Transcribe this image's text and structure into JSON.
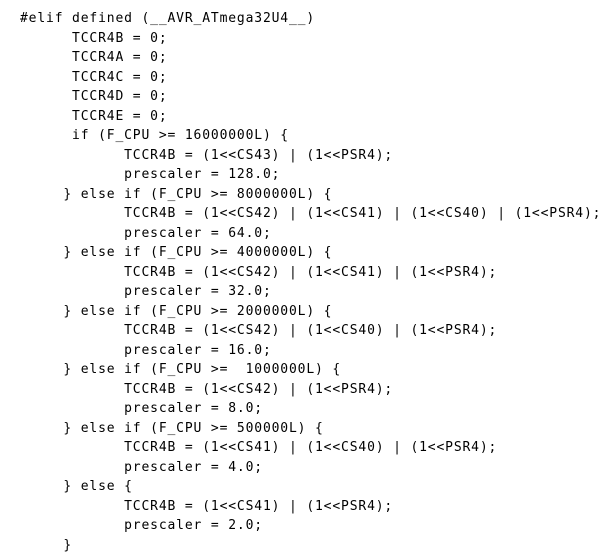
{
  "document": {
    "kind": "source-code-listing",
    "language": "c",
    "background_color": "#ffffff",
    "text_color": "#000000",
    "lines": [
      {
        "n": 1,
        "text": "#elif defined (__AVR_ATmega32U4__)"
      },
      {
        "n": 2,
        "text": "      TCCR4B = 0;"
      },
      {
        "n": 3,
        "text": "      TCCR4A = 0;"
      },
      {
        "n": 4,
        "text": "      TCCR4C = 0;"
      },
      {
        "n": 5,
        "text": "      TCCR4D = 0;"
      },
      {
        "n": 6,
        "text": "      TCCR4E = 0;"
      },
      {
        "n": 7,
        "text": "      if (F_CPU >= 16000000L) {"
      },
      {
        "n": 8,
        "text": "            TCCR4B = (1<<CS43) | (1<<PSR4);"
      },
      {
        "n": 9,
        "text": "            prescaler = 128.0;"
      },
      {
        "n": 10,
        "text": "     } else if (F_CPU >= 8000000L) {"
      },
      {
        "n": 11,
        "text": "            TCCR4B = (1<<CS42) | (1<<CS41) | (1<<CS40) | (1<<PSR4);"
      },
      {
        "n": 12,
        "text": "            prescaler = 64.0;"
      },
      {
        "n": 13,
        "text": "     } else if (F_CPU >= 4000000L) {"
      },
      {
        "n": 14,
        "text": "            TCCR4B = (1<<CS42) | (1<<CS41) | (1<<PSR4);"
      },
      {
        "n": 15,
        "text": "            prescaler = 32.0;"
      },
      {
        "n": 16,
        "text": "     } else if (F_CPU >= 2000000L) {"
      },
      {
        "n": 17,
        "text": "            TCCR4B = (1<<CS42) | (1<<CS40) | (1<<PSR4);"
      },
      {
        "n": 18,
        "text": "            prescaler = 16.0;"
      },
      {
        "n": 19,
        "text": "     } else if (F_CPU >=  1000000L) {"
      },
      {
        "n": 20,
        "text": "            TCCR4B = (1<<CS42) | (1<<PSR4);"
      },
      {
        "n": 21,
        "text": "            prescaler = 8.0;"
      },
      {
        "n": 22,
        "text": "     } else if (F_CPU >= 500000L) {"
      },
      {
        "n": 23,
        "text": "            TCCR4B = (1<<CS41) | (1<<CS40) | (1<<PSR4);"
      },
      {
        "n": 24,
        "text": "            prescaler = 4.0;"
      },
      {
        "n": 25,
        "text": "     } else {"
      },
      {
        "n": 26,
        "text": "            TCCR4B = (1<<CS41) | (1<<PSR4);"
      },
      {
        "n": 27,
        "text": "            prescaler = 2.0;"
      },
      {
        "n": 28,
        "text": "     }"
      }
    ]
  }
}
